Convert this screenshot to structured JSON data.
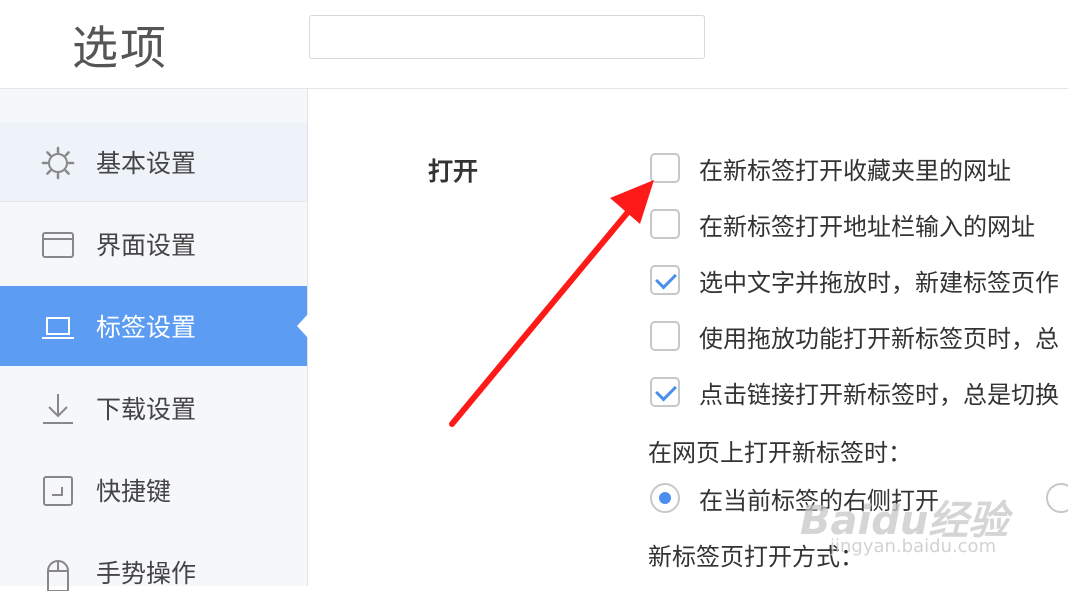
{
  "header": {
    "title": "选项",
    "search": {
      "value": "",
      "placeholder": ""
    }
  },
  "sidebar": {
    "items": [
      {
        "label": "基本设置",
        "icon": "gear-icon"
      },
      {
        "label": "界面设置",
        "icon": "window-icon"
      },
      {
        "label": "标签设置",
        "icon": "laptop-icon",
        "active": true
      },
      {
        "label": "下载设置",
        "icon": "download-icon"
      },
      {
        "label": "快捷键",
        "icon": "keyboard-shortcut-icon"
      },
      {
        "label": "手势操作",
        "icon": "mouse-icon"
      }
    ]
  },
  "main": {
    "section_label": "打开",
    "options": [
      {
        "label": "在新标签打开收藏夹里的网址",
        "checked": false
      },
      {
        "label": "在新标签打开地址栏输入的网址",
        "checked": false
      },
      {
        "label": "选中文字并拖放时，新建标签页作",
        "checked": true
      },
      {
        "label": "使用拖放功能打开新标签页时，总",
        "checked": false
      },
      {
        "label": "点击链接打开新标签时，总是切换",
        "checked": true
      }
    ],
    "new_tab_position": {
      "heading": "在网页上打开新标签时：",
      "choices": [
        {
          "label": "在当前标签的右侧打开",
          "selected": true
        },
        {
          "label": "",
          "selected": false
        }
      ]
    },
    "new_tab_open_mode": {
      "heading": "新标签页打开方式："
    }
  },
  "watermark": {
    "text": "Baidu经验",
    "sub": "jingyan.baidu.com"
  },
  "colors": {
    "accent": "#5c9cf2",
    "check": "#4a8ff0",
    "annotation": "#ff1a1a"
  }
}
